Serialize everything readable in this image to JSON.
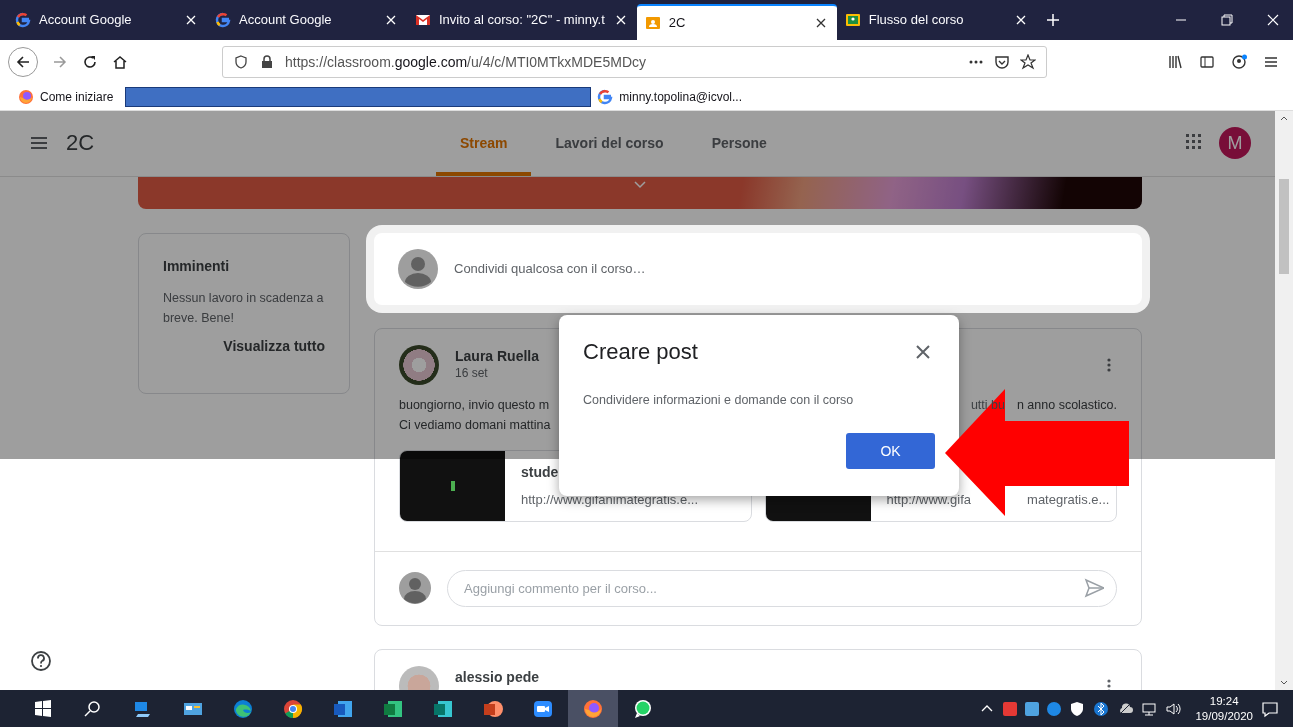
{
  "browser": {
    "tabs": [
      {
        "title": "Account Google",
        "kind": "google",
        "selected": false
      },
      {
        "title": "Account Google",
        "kind": "google",
        "selected": false
      },
      {
        "title": "Invito al corso: \"2C\" - minny.t",
        "kind": "gmail",
        "selected": false
      },
      {
        "title": "2C",
        "kind": "classroom",
        "selected": true
      },
      {
        "title": "Flusso del corso",
        "kind": "flow",
        "selected": false
      }
    ],
    "url": "https://classroom.**google.com**/u/4/c/MTI0MTkxMDE5MDcy",
    "bookmarks": [
      {
        "label": "Come iniziare",
        "kind": "firefox"
      },
      {
        "kind": "redacted"
      },
      {
        "label": "minny.topolina@icvol...",
        "kind": "google"
      }
    ]
  },
  "app": {
    "title": "2C",
    "nav": [
      {
        "label": "Stream",
        "selected": true
      },
      {
        "label": "Lavori del corso",
        "selected": false
      },
      {
        "label": "Persone",
        "selected": false
      }
    ],
    "avatar": "M"
  },
  "upcoming": {
    "title": "Imminenti",
    "text": "Nessun lavoro in scadenza a breve. Bene!",
    "link": "Visualizza tutto"
  },
  "share": {
    "placeholder": "Condividi qualcosa con il corso…"
  },
  "posts": [
    {
      "author": "Laura Ruella",
      "date": "16 set",
      "lines": [
        {
          "left": "buongiorno,  invio questo m",
          "right": [
            "utti bu",
            "n anno scolastico."
          ]
        },
        {
          "left": "Ci vediamo domani mattina"
        }
      ],
      "attachments": [
        {
          "title": "stude",
          "url": [
            "http://www.gifanimategratis.e..."
          ]
        },
        {
          "url": [
            "http://www.gifa",
            "mategratis.e..."
          ]
        }
      ],
      "comment_placeholder": "Aggiungi commento per il corso..."
    },
    {
      "author": "alessio pede"
    }
  ],
  "dialog": {
    "title": "Creare post",
    "body": "Condividere informazioni e domande con il corso",
    "button": "OK"
  },
  "taskbar": {
    "apps": [
      {
        "kind": "start",
        "selected": false
      },
      {
        "kind": "search",
        "selected": false
      },
      {
        "kind": "people",
        "selected": false
      },
      {
        "kind": "tile",
        "selected": false
      },
      {
        "kind": "edge",
        "selected": false
      },
      {
        "kind": "chrome",
        "selected": false
      },
      {
        "kind": "word",
        "selected": false
      },
      {
        "kind": "excel",
        "selected": false
      },
      {
        "kind": "publisher",
        "selected": false
      },
      {
        "kind": "powerpoint",
        "selected": false
      },
      {
        "kind": "zoom",
        "selected": false
      },
      {
        "kind": "firefox",
        "selected": true
      },
      {
        "kind": "whatsapp",
        "selected": false
      }
    ],
    "time": "19:24",
    "date": "19/09/2020"
  }
}
